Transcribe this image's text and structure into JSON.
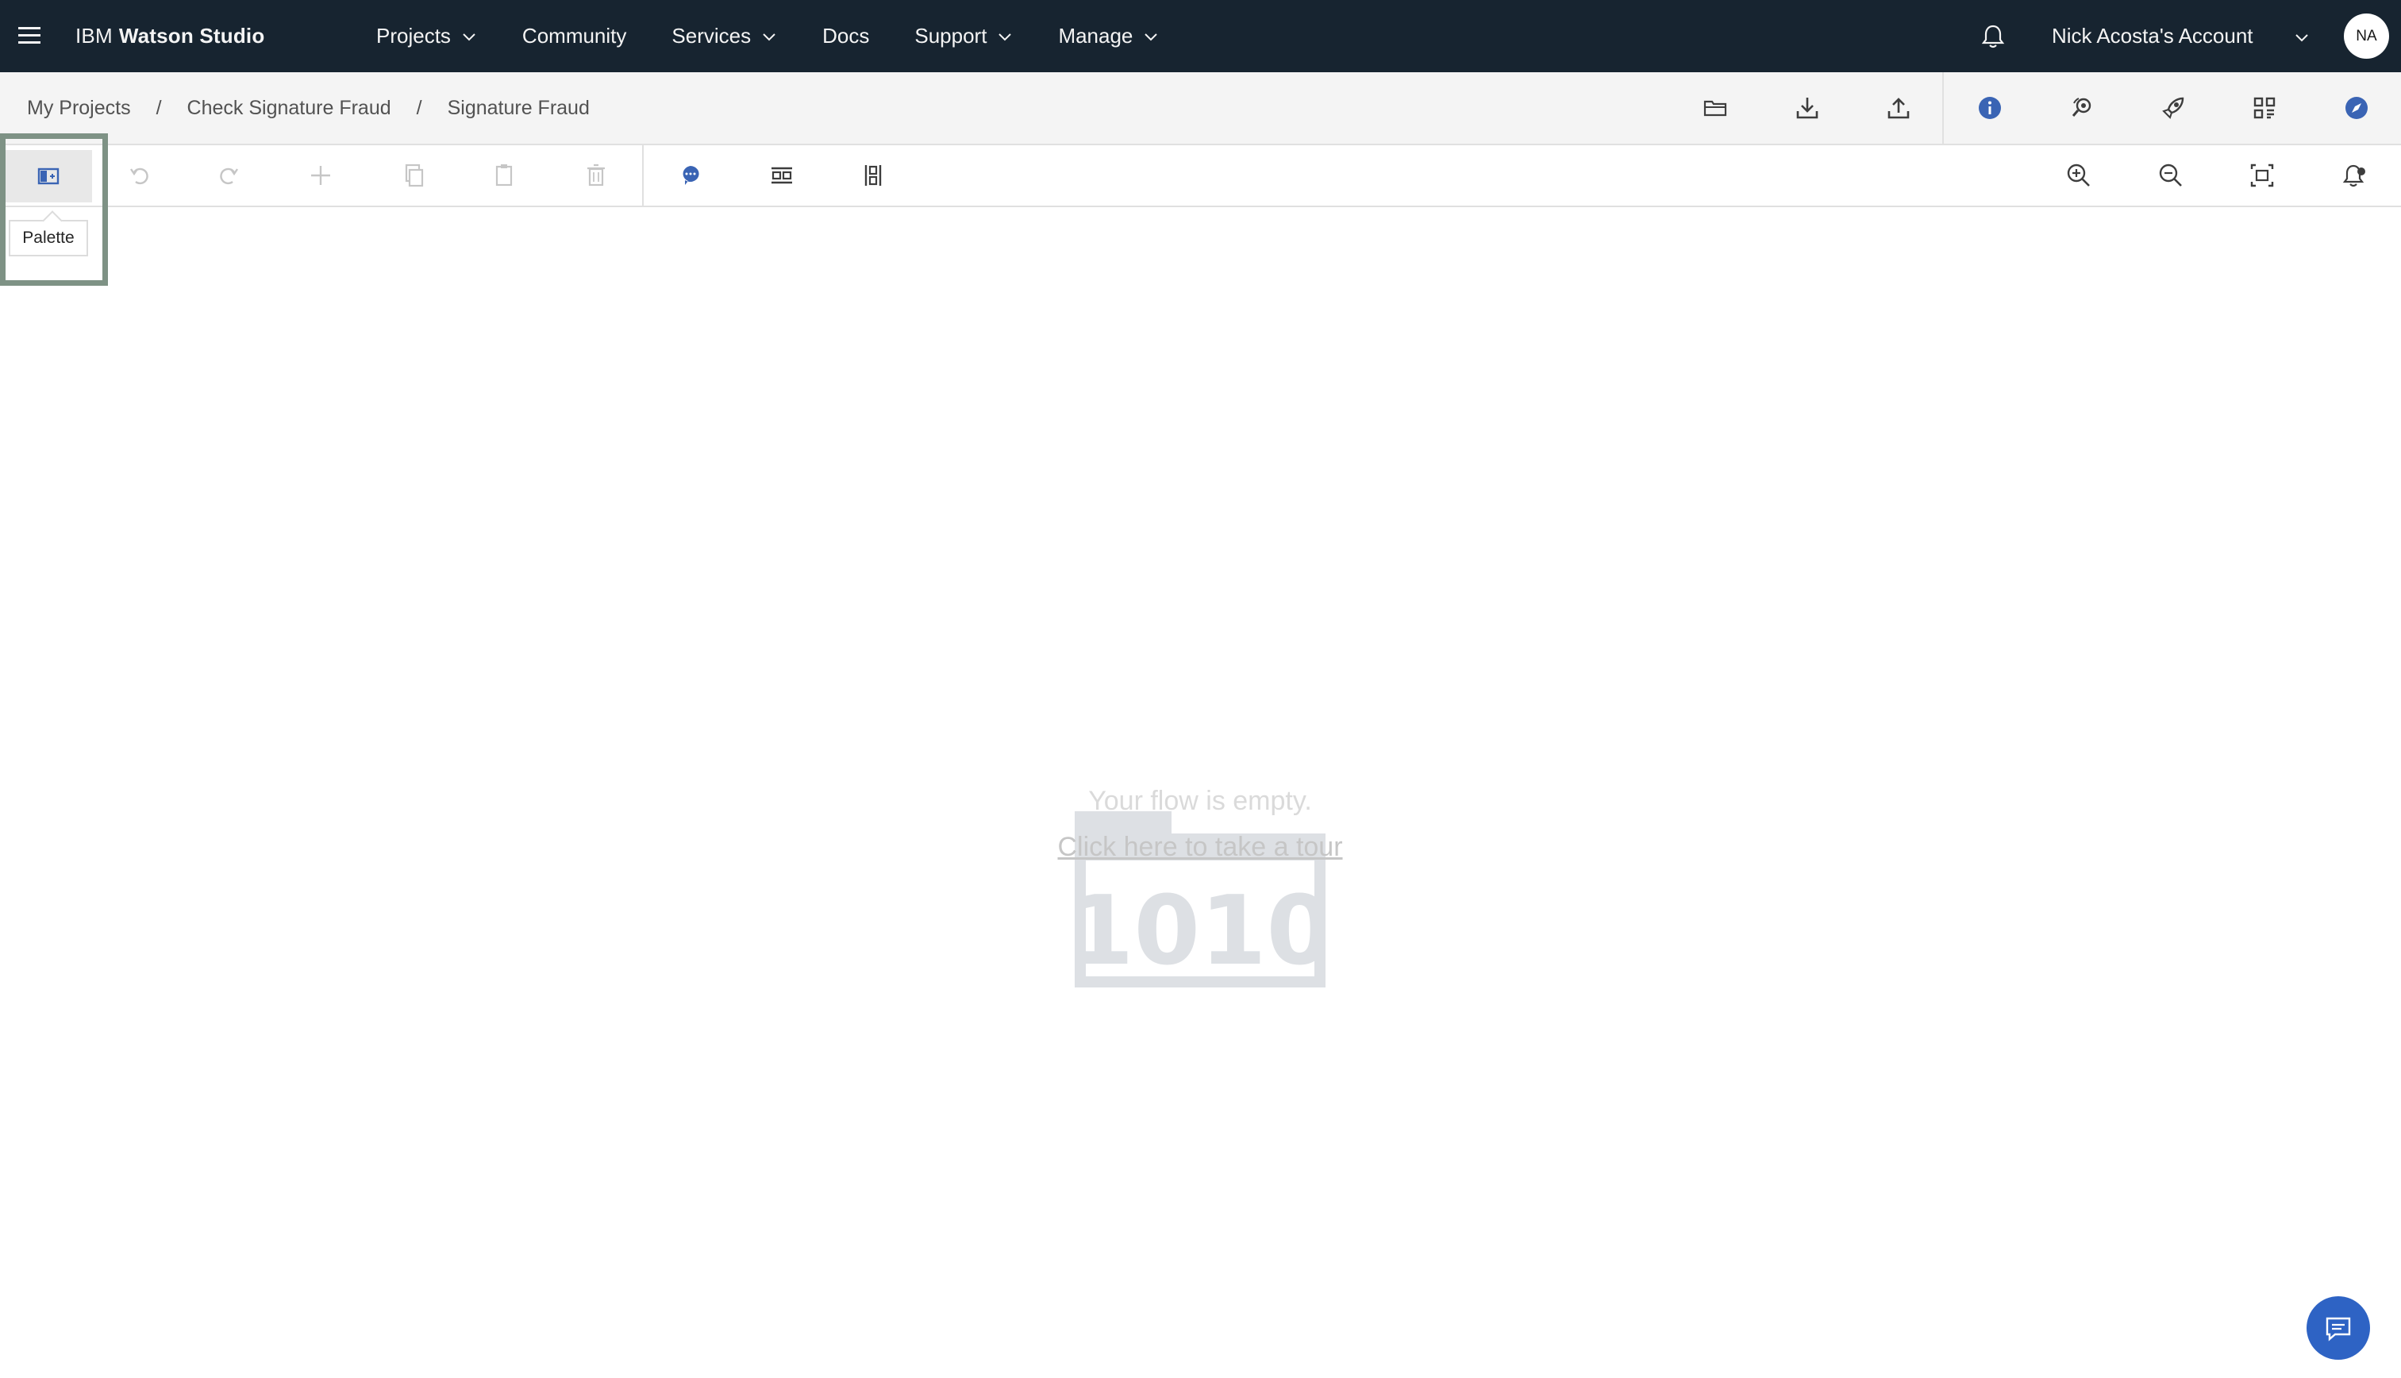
{
  "topnav": {
    "brand_prefix": "IBM",
    "brand_name": "Watson Studio",
    "menu": [
      {
        "label": "Projects",
        "has_dropdown": true
      },
      {
        "label": "Community",
        "has_dropdown": false
      },
      {
        "label": "Services",
        "has_dropdown": true
      },
      {
        "label": "Docs",
        "has_dropdown": false
      },
      {
        "label": "Support",
        "has_dropdown": true
      },
      {
        "label": "Manage",
        "has_dropdown": true
      }
    ],
    "account_label": "Nick Acosta's Account",
    "avatar_initials": "NA"
  },
  "breadcrumb": {
    "items": [
      "My Projects",
      "Check Signature Fraud",
      "Signature Fraud"
    ],
    "separator": "/"
  },
  "toolbar": {
    "palette_tooltip": "Palette"
  },
  "canvas": {
    "empty_message": "Your flow is empty.",
    "tour_link": "Click here to take a tour",
    "illustration_text": "1010"
  },
  "colors": {
    "nav_background": "#172430",
    "accent_blue": "#3a64b4",
    "chat_button": "#2e63c4",
    "highlight_border": "#7e9285"
  }
}
